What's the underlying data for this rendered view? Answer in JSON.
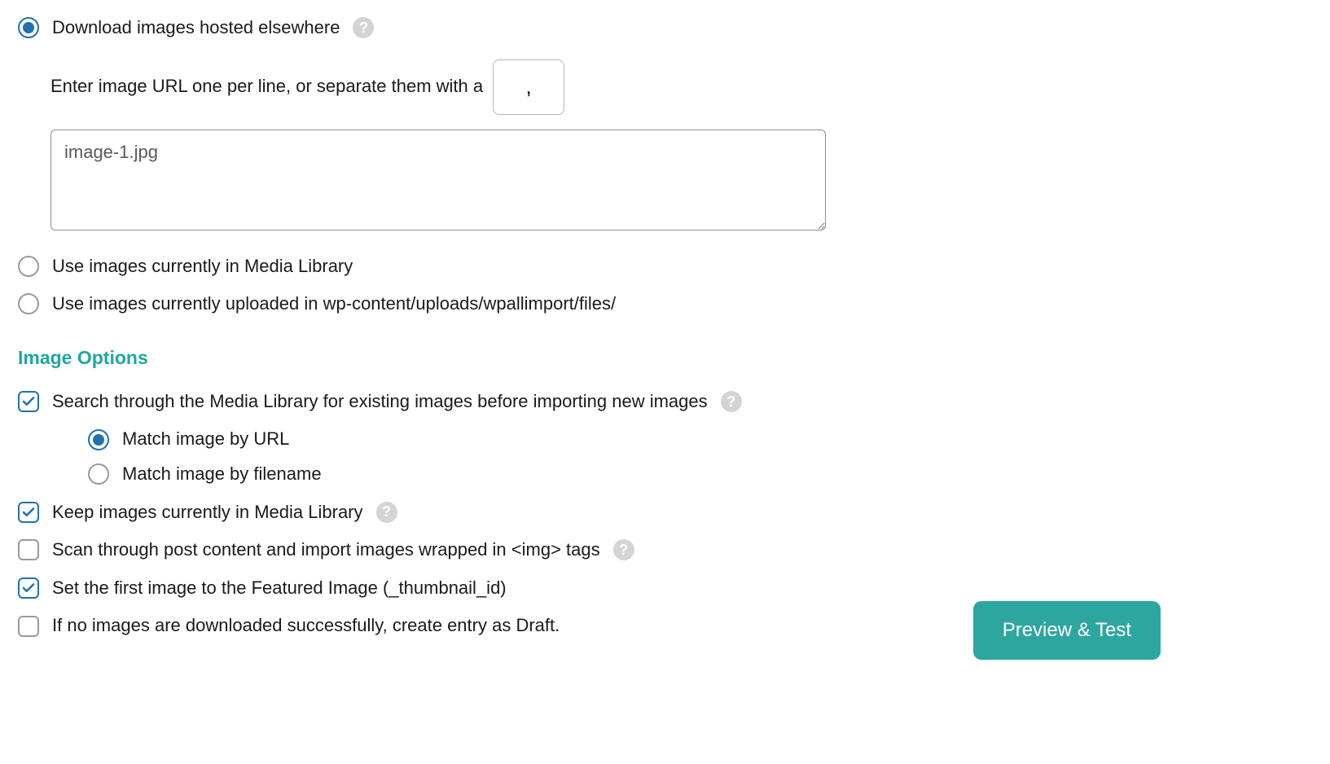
{
  "source": {
    "options": {
      "download": "Download images hosted elsewhere",
      "media_library": "Use images currently in Media Library",
      "uploads_folder": "Use images currently uploaded in wp-content/uploads/wpallimport/files/"
    },
    "url_hint": "Enter image URL one per line, or separate them with a",
    "separator": ",",
    "url_value": "image-1.jpg"
  },
  "section_title": "Image Options",
  "options": {
    "search_media": "Search through the Media Library for existing images before importing new images",
    "match_url": "Match image by URL",
    "match_filename": "Match image by filename",
    "keep_images": "Keep images currently in Media Library",
    "scan_content": "Scan through post content and import images wrapped in <img> tags",
    "set_featured": "Set the first image to the Featured Image (_thumbnail_id)",
    "draft_on_fail": "If no images are downloaded successfully, create entry as Draft."
  },
  "buttons": {
    "preview": "Preview & Test"
  },
  "help_glyph": "?"
}
